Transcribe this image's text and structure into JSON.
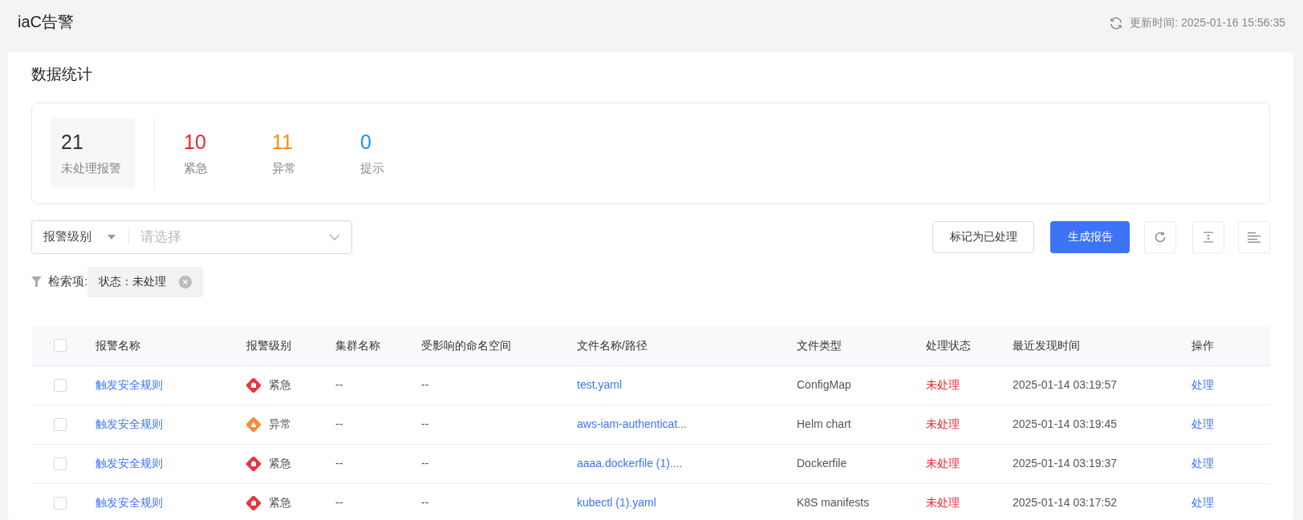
{
  "header": {
    "title": "iaC告警",
    "updated": "更新时间: 2025-01-16 15:56:35"
  },
  "section_title": "数据统计",
  "stats": [
    {
      "value": "21",
      "label": "未处理报警",
      "selected": true,
      "color": "#333333"
    },
    {
      "value": "10",
      "label": "紧急",
      "selected": false,
      "color": "#f5222d"
    },
    {
      "value": "11",
      "label": "异常",
      "selected": false,
      "color": "#fa8c16"
    },
    {
      "value": "0",
      "label": "提示",
      "selected": false,
      "color": "#1890ff"
    }
  ],
  "filter": {
    "field": "报警级别",
    "placeholder": "请选择"
  },
  "actions": {
    "mark_button": "标记为已处理",
    "report_button": "生成报告"
  },
  "search_items": {
    "label": "检索项:",
    "tags": [
      "状态：未处理"
    ]
  },
  "table": {
    "select_all_checked": false,
    "columns": [
      "报警名称",
      "报警级别",
      "集群名称",
      "受影响的命名空间",
      "文件名称/路径",
      "文件类型",
      "处理状态",
      "最近发现时间",
      "操作"
    ],
    "rows": [
      {
        "checked": false,
        "name": "触发安全规则",
        "kind": "urgent",
        "level": "紧急",
        "cluster": "--",
        "namespace": "--",
        "file": "test.yaml",
        "file_type": "ConfigMap",
        "status": "未处理",
        "time": "2025-01-14 03:19:57",
        "action": "处理"
      },
      {
        "checked": false,
        "name": "触发安全规则",
        "kind": "warning",
        "level": "异常",
        "cluster": "--",
        "namespace": "--",
        "file": "aws-iam-authenticat...",
        "file_type": "Helm chart",
        "status": "未处理",
        "time": "2025-01-14 03:19:45",
        "action": "处理"
      },
      {
        "checked": false,
        "name": "触发安全规则",
        "kind": "urgent",
        "level": "紧急",
        "cluster": "--",
        "namespace": "--",
        "file": "aaaa.dockerfile (1)....",
        "file_type": "Dockerfile",
        "status": "未处理",
        "time": "2025-01-14 03:19:37",
        "action": "处理"
      },
      {
        "checked": false,
        "name": "触发安全规则",
        "kind": "urgent",
        "level": "紧急",
        "cluster": "--",
        "namespace": "--",
        "file": "kubectl (1).yaml",
        "file_type": "K8S manifests",
        "status": "未处理",
        "time": "2025-01-14 03:17:52",
        "action": "处理"
      }
    ]
  }
}
